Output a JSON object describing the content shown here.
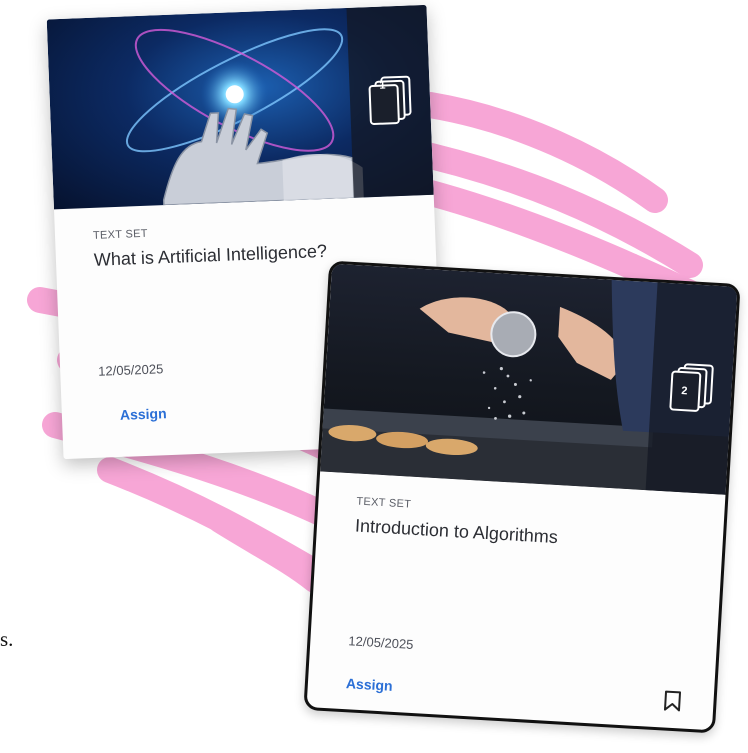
{
  "colors": {
    "scribble": "#f7a6d6",
    "accent_link": "#2b6fd6",
    "card_border": "#111111"
  },
  "edge_text": "s.",
  "cards": [
    {
      "type_label": "TEXT SET",
      "title": "What is Artificial Intelligence?",
      "date": "12/05/2025",
      "assign_label": "Assign",
      "stack_count": "1",
      "thumbnail_icon": "stack-icon"
    },
    {
      "type_label": "TEXT SET",
      "title": "Introduction to Algorithms",
      "date": "12/05/2025",
      "assign_label": "Assign",
      "stack_count": "2",
      "thumbnail_icon": "stack-icon",
      "action_icon": "bookmark-icon"
    }
  ]
}
